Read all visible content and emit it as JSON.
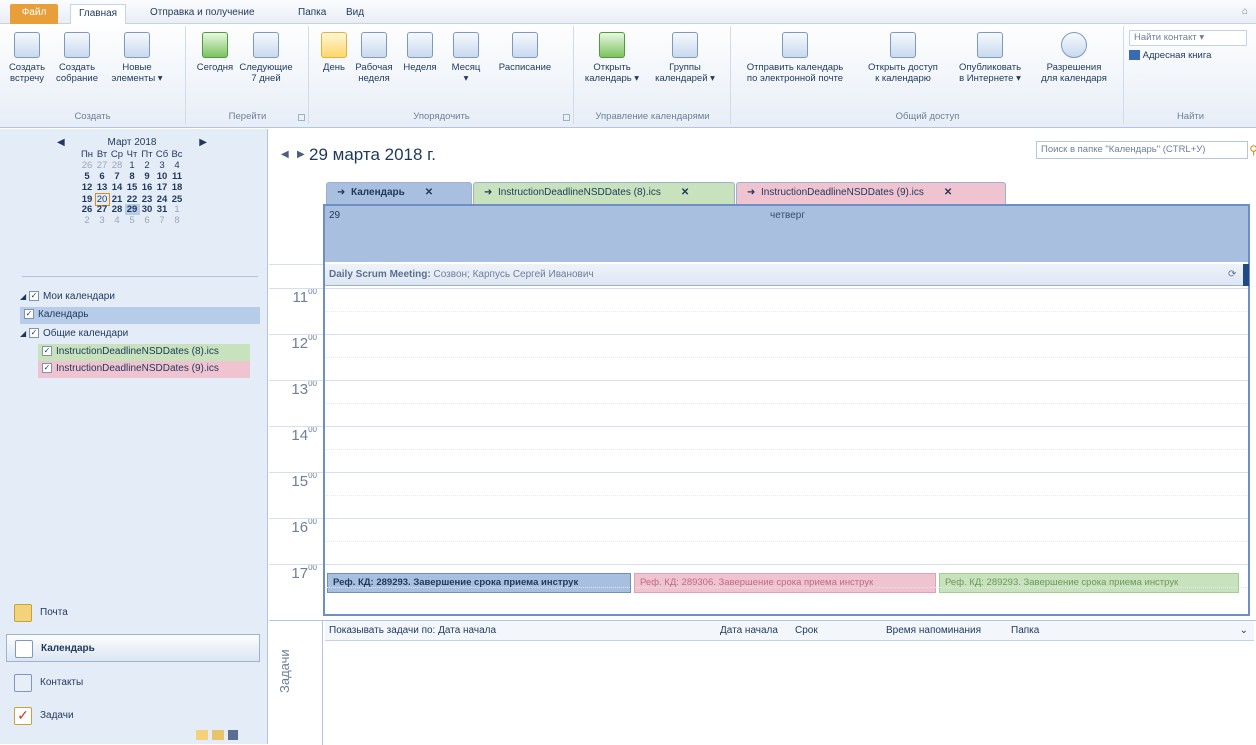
{
  "tabs": [
    {
      "label": "Файл"
    },
    {
      "label": "Главная"
    },
    {
      "label": "Отправка и получение"
    },
    {
      "label": "Папка"
    },
    {
      "label": "Вид"
    }
  ],
  "ribbon": {
    "groups": {
      "create": "Создать",
      "goto": "Перейти",
      "arrange": "Упорядочить",
      "manage": "Управление календарями",
      "share": "Общий доступ",
      "find": "Найти"
    },
    "buttons": {
      "new_appt": [
        "Создать",
        "встречу"
      ],
      "new_meeting": [
        "Создать",
        "собрание"
      ],
      "new_items": [
        "Новые",
        "элементы ▾"
      ],
      "today": [
        "Сегодня",
        ""
      ],
      "next7": [
        "Следующие",
        "7 дней"
      ],
      "day": [
        "День",
        ""
      ],
      "workweek": [
        "Рабочая",
        "неделя"
      ],
      "week": [
        "Неделя",
        ""
      ],
      "month": [
        "Месяц",
        "▾"
      ],
      "schedule": [
        "Расписание",
        ""
      ],
      "open_cal": [
        "Открыть",
        "календарь ▾"
      ],
      "cal_groups": [
        "Группы",
        "календарей ▾"
      ],
      "email_cal": [
        "Отправить календарь",
        "по электронной почте"
      ],
      "share_cal": [
        "Открыть доступ",
        "к календарю"
      ],
      "publish": [
        "Опубликовать",
        "в Интернете ▾"
      ],
      "permissions": [
        "Разрешения",
        "для календаря"
      ]
    },
    "find_contact": "Найти контакт ▾",
    "address_book": "Адресная книга"
  },
  "mini_calendar": {
    "title": "Март 2018",
    "weekdays": [
      "Пн",
      "Вт",
      "Ср",
      "Чт",
      "Пт",
      "Сб",
      "Вс"
    ],
    "weeks": [
      [
        "26",
        "27",
        "28",
        "1",
        "2",
        "3",
        "4"
      ],
      [
        "5",
        "6",
        "7",
        "8",
        "9",
        "10",
        "11"
      ],
      [
        "12",
        "13",
        "14",
        "15",
        "16",
        "17",
        "18"
      ],
      [
        "19",
        "20",
        "21",
        "22",
        "23",
        "24",
        "25"
      ],
      [
        "26",
        "27",
        "28",
        "29",
        "30",
        "31",
        "1"
      ],
      [
        "2",
        "3",
        "4",
        "5",
        "6",
        "7",
        "8"
      ]
    ]
  },
  "calendars": {
    "my_header": "Мои календари",
    "my_items": [
      "Календарь"
    ],
    "shared_header": "Общие календари",
    "shared_items": [
      "InstructionDeadlineNSDDates (8).ics",
      "InstructionDeadlineNSDDates (9).ics"
    ]
  },
  "nav": {
    "mail": "Почта",
    "calendar": "Календарь",
    "contacts": "Контакты",
    "tasks": "Задачи"
  },
  "main": {
    "date_title": "29 марта 2018 г.",
    "search_placeholder": "Поиск в папке \"Календарь\" (CTRL+У)",
    "cal_tabs": [
      {
        "label": "Календарь",
        "color": "#a9bfe0"
      },
      {
        "label": "InstructionDeadlineNSDDates (8).ics",
        "color": "#c7e2bd"
      },
      {
        "label": "InstructionDeadlineNSDDates (9).ics",
        "color": "#f0c3d1"
      }
    ],
    "day_number": "29",
    "day_name": "четверг",
    "allday_title": "Daily Scrum Meeting:",
    "allday_detail": "Созвон; Карпусь Сергей Иванович",
    "hours": [
      "11",
      "12",
      "13",
      "14",
      "15",
      "16",
      "17"
    ],
    "hour_suffix": "00",
    "events": [
      {
        "text": "Реф. КД: 289293. Завершение срока приема инструк"
      },
      {
        "text": "Реф. КД: 289306. Завершение срока приема инструк"
      },
      {
        "text": "Реф. КД: 289293. Завершение срока приема инструк"
      }
    ]
  },
  "tasks_pane": {
    "side_label": "Задачи",
    "show_by": "Показывать задачи по: Дата начала",
    "col_start": "Дата начала",
    "col_due": "Срок",
    "col_reminder": "Время напоминания",
    "col_folder": "Папка"
  }
}
